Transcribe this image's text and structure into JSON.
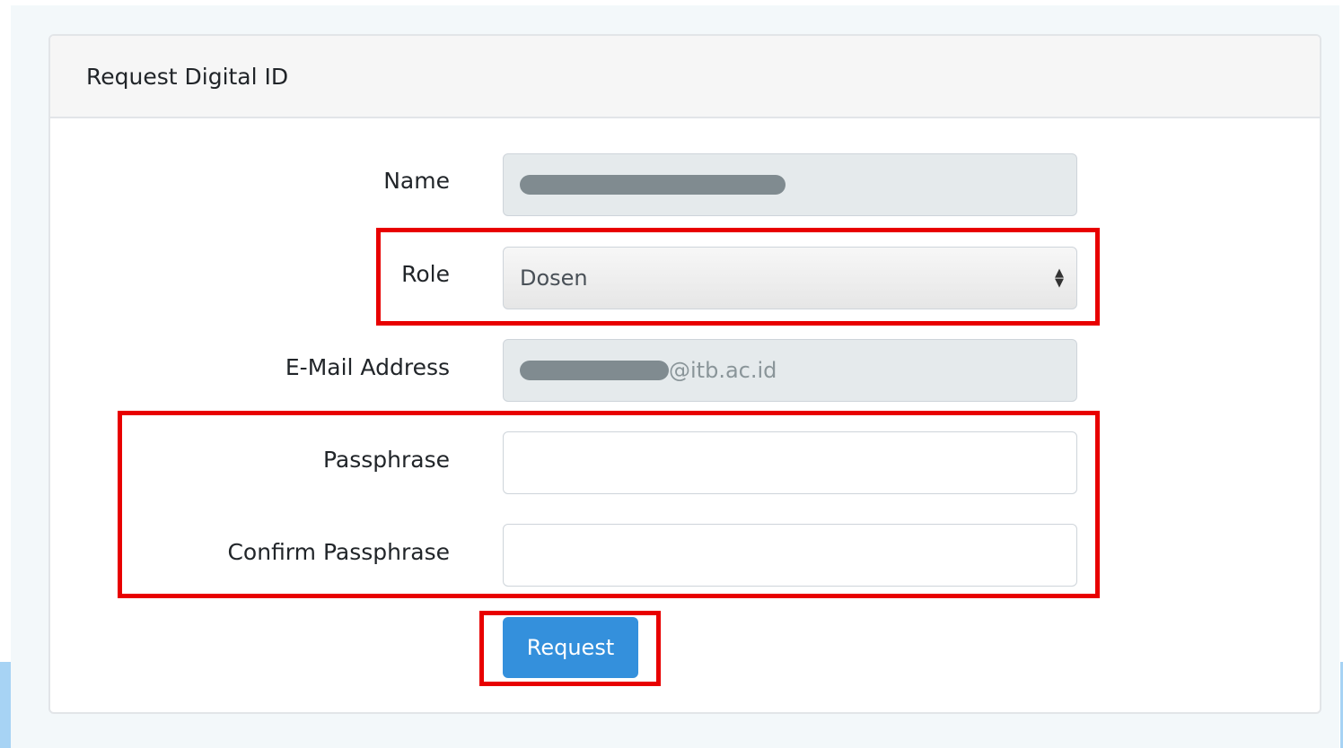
{
  "form": {
    "title": "Request Digital ID",
    "name_label": "Name",
    "role_label": "Role",
    "role_value": "Dosen",
    "email_label": "E-Mail Address",
    "email_visible_suffix": "@itb.ac.id",
    "passphrase_label": "Passphrase",
    "confirm_passphrase_label": "Confirm Passphrase",
    "submit_label": "Request"
  },
  "colors": {
    "primary_button": "#3490dc",
    "highlight_box": "#e80000"
  }
}
